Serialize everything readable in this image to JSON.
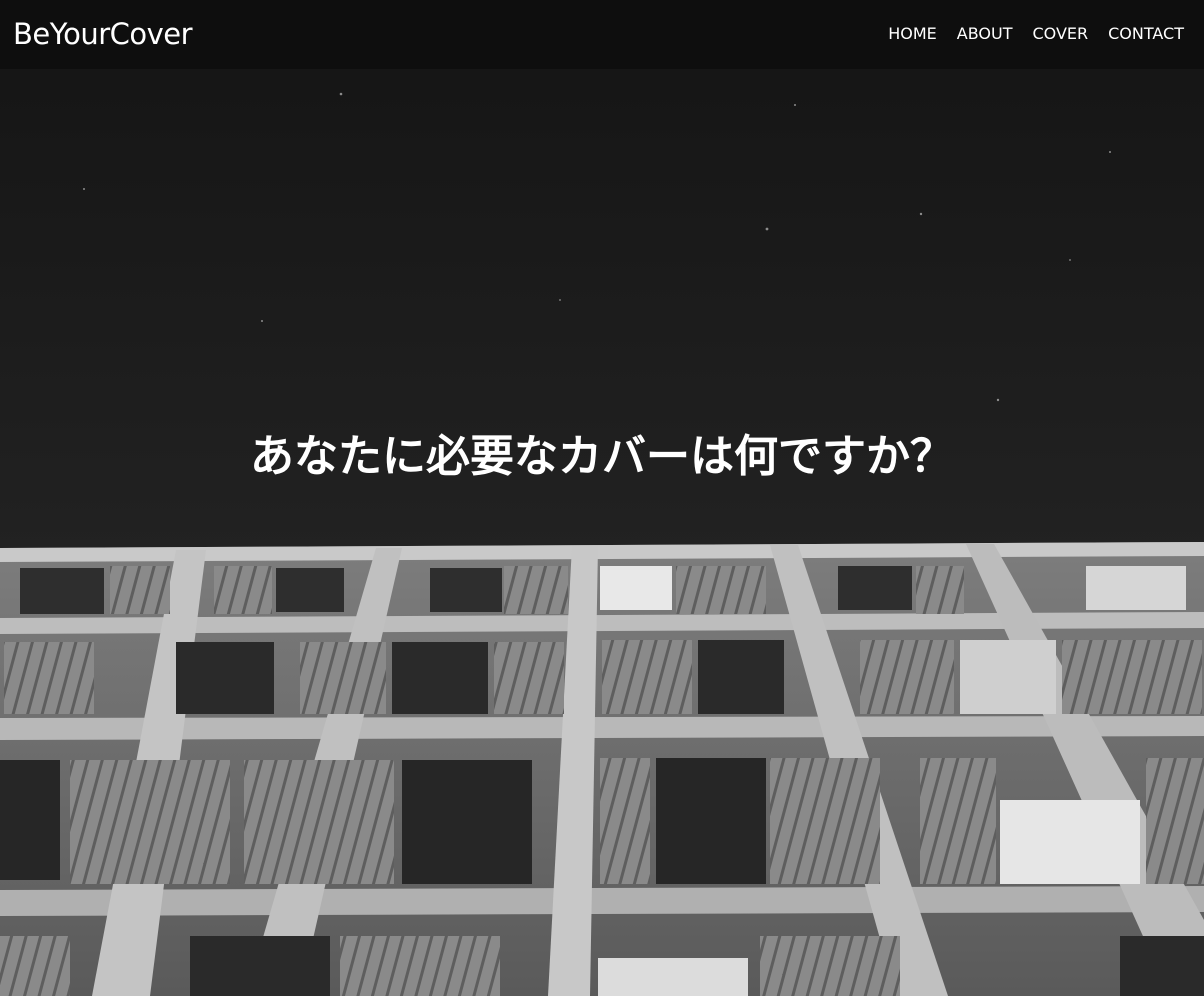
{
  "header": {
    "logo": "BeYourCover",
    "nav": [
      {
        "label": "HOME"
      },
      {
        "label": "ABOUT"
      },
      {
        "label": "COVER"
      },
      {
        "label": "CONTACT"
      }
    ]
  },
  "hero": {
    "headline": "あなたに必要なカバーは何ですか？"
  },
  "colors": {
    "header_bg": "#0e0e0e",
    "sky": "#1c1c1c",
    "text": "#ffffff"
  }
}
